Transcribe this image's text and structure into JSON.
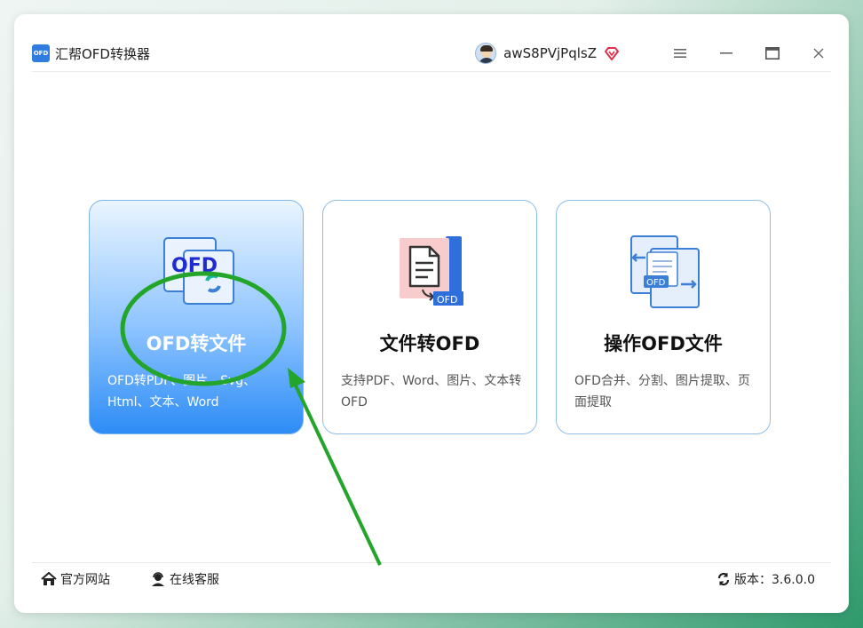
{
  "app": {
    "title": "汇帮OFD转换器",
    "logo_text": "OFD"
  },
  "user": {
    "name": "awS8PVjPqlsZ"
  },
  "window_controls": [
    "menu-icon",
    "minimize-icon",
    "maximize-icon",
    "close-icon"
  ],
  "cards": [
    {
      "title": "OFD转文件",
      "description": "OFD转PDF、图片、Svg、Html、文本、Word",
      "icon_text": "OFD",
      "active": true
    },
    {
      "title": "文件转OFD",
      "description": "支持PDF、Word、图片、文本转OFD",
      "icon_text": "OFD",
      "active": false
    },
    {
      "title": "操作OFD文件",
      "description": "OFD合并、分割、图片提取、页面提取",
      "icon_text": "OFD",
      "active": false
    }
  ],
  "footer": {
    "website_label": "官方网站",
    "service_label": "在线客服",
    "version_label": "版本：3.6.0.0"
  },
  "colors": {
    "accent": "#2d8cf6",
    "annotation": "#22a52a"
  }
}
